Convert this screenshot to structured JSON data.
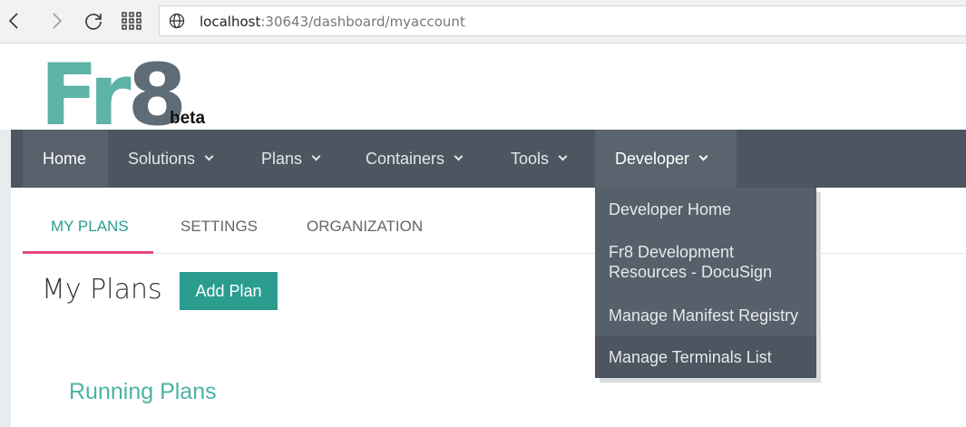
{
  "browser": {
    "url_host": "localhost",
    "url_rest": ":30643/dashboard/myaccount"
  },
  "logo": {
    "fr": "Fr",
    "eight": "8",
    "beta": "beta"
  },
  "nav": {
    "items": [
      {
        "label": "Home"
      },
      {
        "label": "Solutions"
      },
      {
        "label": "Plans"
      },
      {
        "label": "Containers"
      },
      {
        "label": "Tools"
      },
      {
        "label": "Developer"
      }
    ],
    "active": "Home",
    "open_menu": "Developer"
  },
  "developer_menu": {
    "items": [
      {
        "label": "Developer Home"
      },
      {
        "label": "Fr8 Development Resources - DocuSign"
      },
      {
        "label": "Manage Manifest Registry"
      },
      {
        "label": "Manage Terminals List"
      }
    ],
    "hovered": "Manage Terminals List"
  },
  "tabs": {
    "items": [
      {
        "label": "MY PLANS"
      },
      {
        "label": "SETTINGS"
      },
      {
        "label": "ORGANIZATION"
      }
    ],
    "active": "MY PLANS"
  },
  "main": {
    "title": "My Plans",
    "add_button": "Add Plan",
    "section_title": "Running Plans"
  },
  "colors": {
    "teal": "#2a9d8f",
    "nav_bg": "#4c5560",
    "tab_underline": "#e7467e",
    "logo_teal": "#5cb3a6",
    "logo_gray": "#5e6c78"
  }
}
